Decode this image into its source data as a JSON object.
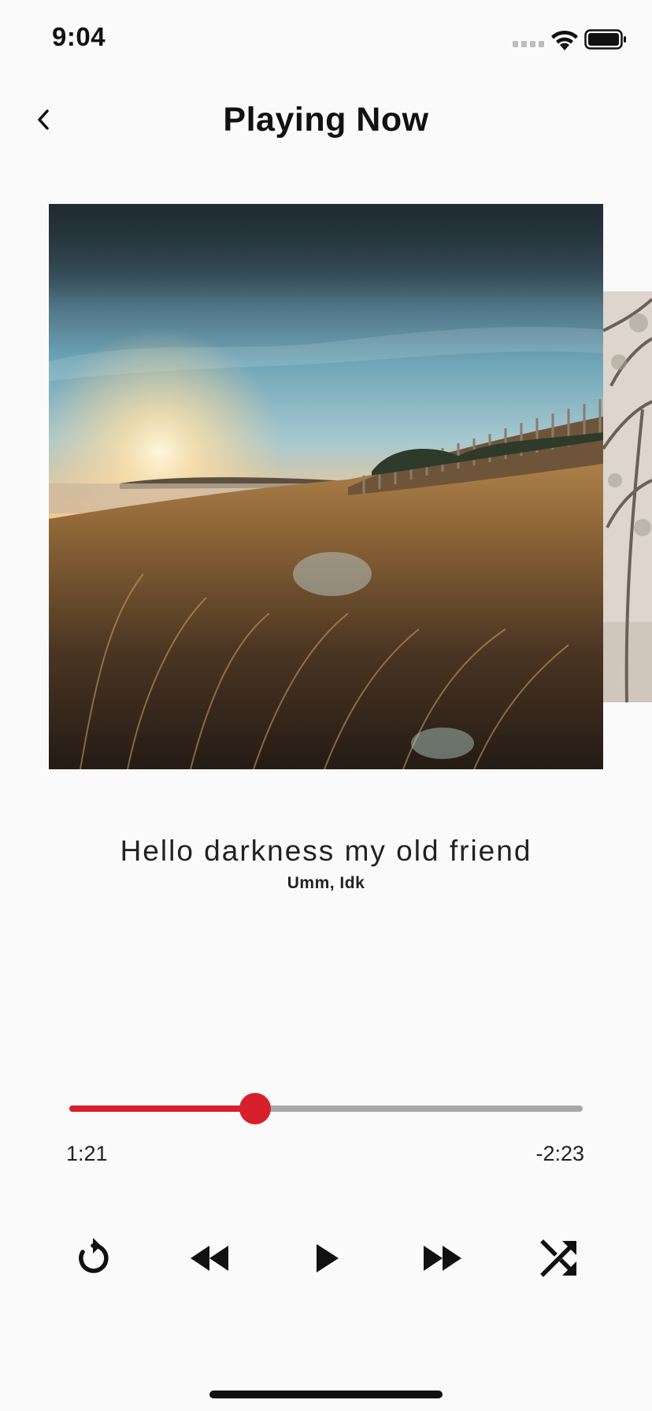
{
  "status_bar": {
    "time": "9:04"
  },
  "header": {
    "title": "Playing Now"
  },
  "track": {
    "title": "Hello darkness my old friend",
    "artist": "Umm, Idk"
  },
  "progress": {
    "elapsed": "1:21",
    "remaining": "-2:23",
    "fraction": 0.362
  },
  "colors": {
    "accent": "#d81f2c",
    "track_bg": "#a8a8a8",
    "background": "#fafafa"
  },
  "icons": {
    "back": "chevron-left-icon",
    "replay": "replay-icon",
    "rewind": "rewind-icon",
    "play": "play-icon",
    "fast_forward": "fast-forward-icon",
    "shuffle": "shuffle-icon"
  }
}
